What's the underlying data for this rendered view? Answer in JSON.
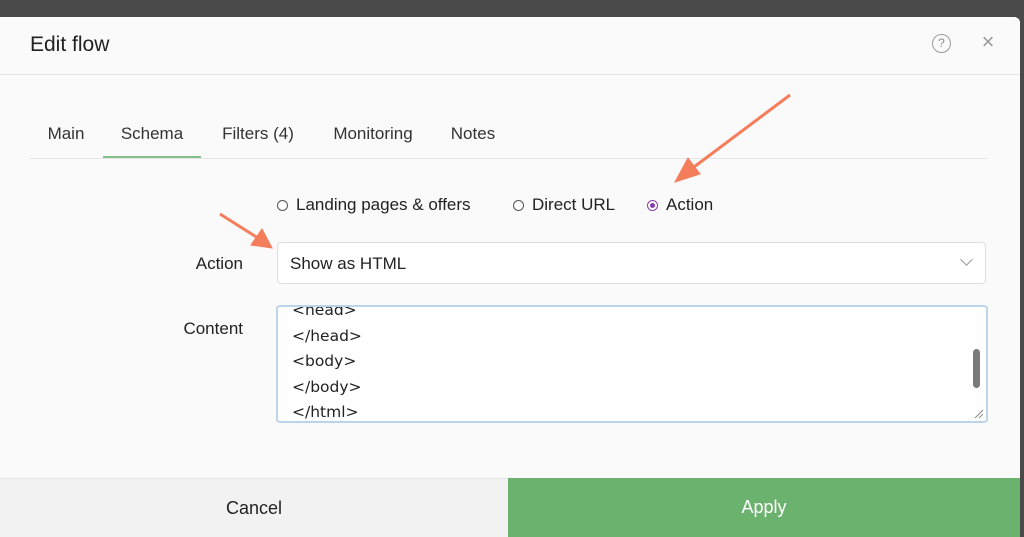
{
  "window": {
    "title": "Edit flow"
  },
  "header": {
    "help_icon": "?",
    "close_icon": "×"
  },
  "tabs": [
    {
      "label": "Main",
      "active": false
    },
    {
      "label": "Schema",
      "active": true
    },
    {
      "label": "Filters (4)",
      "active": false
    },
    {
      "label": "Monitoring",
      "active": false
    },
    {
      "label": "Notes",
      "active": false
    }
  ],
  "schema_type": {
    "options": [
      {
        "label": "Landing pages & offers",
        "checked": false
      },
      {
        "label": "Direct URL",
        "checked": false
      },
      {
        "label": "Action",
        "checked": true
      }
    ]
  },
  "action_field": {
    "label": "Action",
    "value": "Show as HTML"
  },
  "content_field": {
    "label": "Content",
    "lines": [
      "<head>",
      "</head>",
      "<body>",
      "</body>",
      "</html>"
    ]
  },
  "footer": {
    "cancel_label": "Cancel",
    "apply_label": "Apply"
  },
  "colors": {
    "accent_green": "#6cb26f",
    "radio_checked": "#8a3fa8",
    "annotation_arrow": "#f47d5b"
  }
}
